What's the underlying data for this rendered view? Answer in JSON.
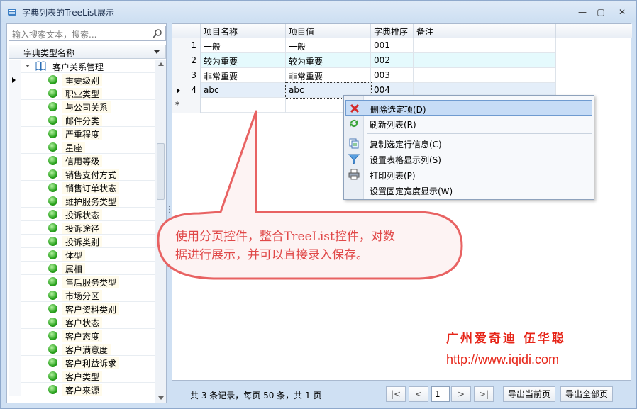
{
  "window": {
    "title": "字典列表的TreeList展示",
    "controls": [
      "—",
      "▢",
      "✕"
    ]
  },
  "left": {
    "search_placeholder": "输入搜索文本，搜索...",
    "column_header": "字典类型名称",
    "root": "客户关系管理",
    "items": [
      "重要级别",
      "职业类型",
      "与公司关系",
      "邮件分类",
      "严重程度",
      "星座",
      "信用等级",
      "销售支付方式",
      "销售订单状态",
      "维护服务类型",
      "投诉状态",
      "投诉途径",
      "投诉类别",
      "体型",
      "属相",
      "售后服务类型",
      "市场分区",
      "客户资料类别",
      "客户状态",
      "客户态度",
      "客户满意度",
      "客户利益诉求",
      "客户类型",
      "客户来源"
    ]
  },
  "grid": {
    "headers": [
      "项目名称",
      "项目值",
      "字典排序",
      "备注"
    ],
    "rows": [
      {
        "num": "1",
        "name": "一般",
        "value": "一般",
        "order": "001",
        "note": ""
      },
      {
        "num": "2",
        "name": "较为重要",
        "value": "较为重要",
        "order": "002",
        "note": ""
      },
      {
        "num": "3",
        "name": "非常重要",
        "value": "非常重要",
        "order": "003",
        "note": ""
      },
      {
        "num": "4",
        "name": "abc",
        "value": "abc",
        "order": "004",
        "note": ""
      }
    ],
    "new_row_marker": "*"
  },
  "context_menu": {
    "items": [
      {
        "label": "删除选定项(D)",
        "icon": "delete-icon"
      },
      {
        "label": "刷新列表(R)",
        "icon": "refresh-icon"
      },
      {
        "label": "复制选定行信息(C)",
        "icon": "copy-icon"
      },
      {
        "label": "设置表格显示列(S)",
        "icon": "filter-icon"
      },
      {
        "label": "打印列表(P)",
        "icon": "print-icon"
      },
      {
        "label": "设置固定宽度显示(W)",
        "icon": ""
      }
    ]
  },
  "callout": {
    "line1": "使用分页控件，整合TreeList控件，对数",
    "line2": "据进行展示，并可以直接录入保存。"
  },
  "watermark": {
    "name": "广州爱奇迪 伍华聪",
    "url": "http://www.iqidi.com"
  },
  "pager": {
    "info": "共 3 条记录，每页 50 条，共 1 页",
    "first": "|<",
    "prev": "<",
    "page": "1",
    "next": ">",
    "last": ">|",
    "export_current": "导出当前页",
    "export_all": "导出全部页"
  },
  "colors": {
    "accent": "#6f9bd0",
    "callout_red": "#e04848",
    "signature_red": "#e62417"
  }
}
